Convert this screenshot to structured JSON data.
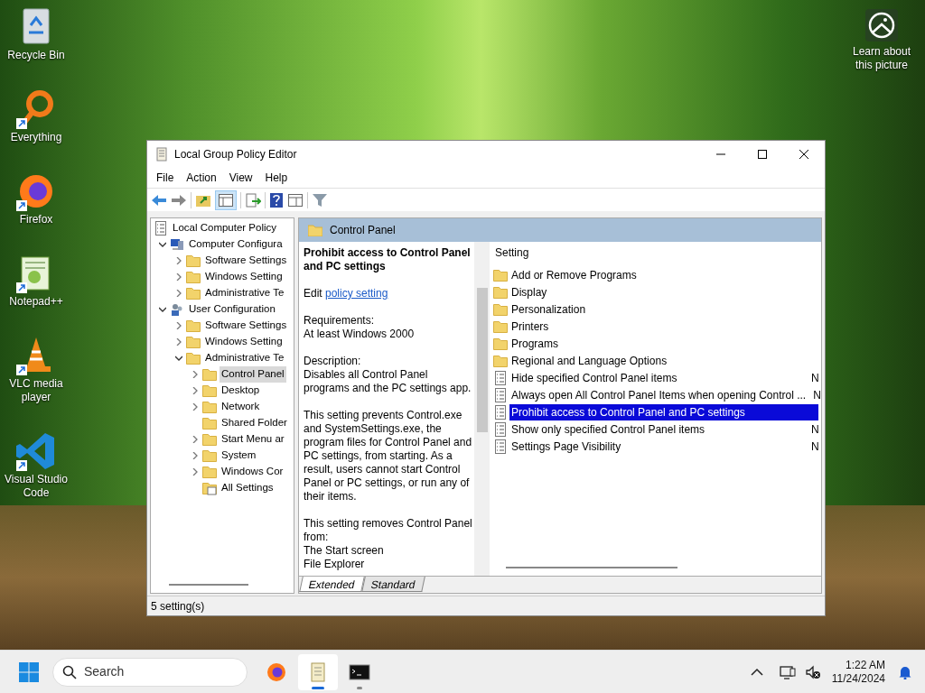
{
  "desktop_icons": [
    {
      "kind": "recycle",
      "label": "Recycle Bin",
      "shortcut": false
    },
    {
      "kind": "everything",
      "label": "Everything",
      "shortcut": true
    },
    {
      "kind": "firefox",
      "label": "Firefox",
      "shortcut": true
    },
    {
      "kind": "notepad",
      "label": "Notepad++",
      "shortcut": true
    },
    {
      "kind": "vlc",
      "label": "VLC media player",
      "shortcut": true
    },
    {
      "kind": "vscode",
      "label": "Visual Studio Code",
      "shortcut": true
    }
  ],
  "spotlight": {
    "label": "Learn about this picture"
  },
  "window": {
    "title": "Local Group Policy Editor"
  },
  "menu": [
    "File",
    "Action",
    "View",
    "Help"
  ],
  "tree": [
    {
      "label": "Local Computer Policy",
      "kind": "policy",
      "selected": false,
      "children": [
        {
          "label": "Computer Configura",
          "kind": "computer",
          "expanded": true,
          "selected": false,
          "children": [
            {
              "label": "Software Settings",
              "kind": "folder",
              "expanded": false,
              "selected": false
            },
            {
              "label": "Windows Setting",
              "kind": "folder",
              "expanded": false,
              "selected": false
            },
            {
              "label": "Administrative Te",
              "kind": "folder",
              "expanded": false,
              "selected": false
            }
          ]
        },
        {
          "label": "User Configuration",
          "kind": "user",
          "expanded": true,
          "selected": false,
          "children": [
            {
              "label": "Software Settings",
              "kind": "folder",
              "expanded": false,
              "selected": false
            },
            {
              "label": "Windows Setting",
              "kind": "folder",
              "expanded": false,
              "selected": false
            },
            {
              "label": "Administrative Te",
              "kind": "folder",
              "expanded": true,
              "selected": false,
              "children": [
                {
                  "label": "Control Panel",
                  "kind": "folder",
                  "expanded": false,
                  "selected": true
                },
                {
                  "label": "Desktop",
                  "kind": "folder",
                  "expanded": false,
                  "selected": false
                },
                {
                  "label": "Network",
                  "kind": "folder",
                  "expanded": false,
                  "selected": false
                },
                {
                  "label": "Shared Folder",
                  "kind": "folder",
                  "selected": false
                },
                {
                  "label": "Start Menu ar",
                  "kind": "folder",
                  "expanded": false,
                  "selected": false
                },
                {
                  "label": "System",
                  "kind": "folder",
                  "expanded": false,
                  "selected": false
                },
                {
                  "label": "Windows Cor",
                  "kind": "folder",
                  "expanded": false,
                  "selected": false
                },
                {
                  "label": "All Settings",
                  "kind": "allsettings",
                  "selected": false
                }
              ]
            }
          ]
        }
      ]
    }
  ],
  "header": {
    "title": "Control Panel"
  },
  "description": {
    "title": "Prohibit access to Control Panel and PC settings",
    "edit_label": "Edit",
    "edit_link": "policy setting",
    "paragraphs": [
      "Requirements:\nAt least Windows 2000",
      "Description:\nDisables all Control Panel programs and the PC settings app.",
      "This setting prevents Control.exe and SystemSettings.exe, the program files for Control Panel and PC settings, from starting. As a result, users cannot start Control Panel or PC settings, or run any of their items.",
      "This setting removes Control Panel from:\nThe Start screen\nFile Explorer"
    ]
  },
  "settings": {
    "columns": [
      "Setting"
    ],
    "rows": [
      {
        "kind": "folder",
        "name": "Add or Remove Programs",
        "selected": false
      },
      {
        "kind": "folder",
        "name": "Display",
        "selected": false
      },
      {
        "kind": "folder",
        "name": "Personalization",
        "selected": false
      },
      {
        "kind": "folder",
        "name": "Printers",
        "selected": false
      },
      {
        "kind": "folder",
        "name": "Programs",
        "selected": false
      },
      {
        "kind": "folder",
        "name": "Regional and Language Options",
        "selected": false
      },
      {
        "kind": "policy",
        "name": "Hide specified Control Panel items",
        "state": "N",
        "selected": false
      },
      {
        "kind": "policy",
        "name": "Always open All Control Panel Items when opening Control ...",
        "state": "N",
        "selected": false
      },
      {
        "kind": "policy",
        "name": "Prohibit access to Control Panel and PC settings",
        "selected": true
      },
      {
        "kind": "policy",
        "name": "Show only specified Control Panel items",
        "state": "N",
        "selected": false
      },
      {
        "kind": "policy",
        "name": "Settings Page Visibility",
        "state": "N",
        "selected": false
      }
    ]
  },
  "tabs": [
    {
      "label": "Extended",
      "selected": true
    },
    {
      "label": "Standard",
      "selected": false
    }
  ],
  "status_bar": "5 setting(s)",
  "taskbar": {
    "search_placeholder": "Search",
    "apps": [
      {
        "kind": "firefox",
        "active": false,
        "running": false
      },
      {
        "kind": "notepad",
        "active": true,
        "running": true
      },
      {
        "kind": "terminal",
        "active": false,
        "running": true
      }
    ],
    "time": "1:22 AM",
    "date": "11/24/2024"
  }
}
